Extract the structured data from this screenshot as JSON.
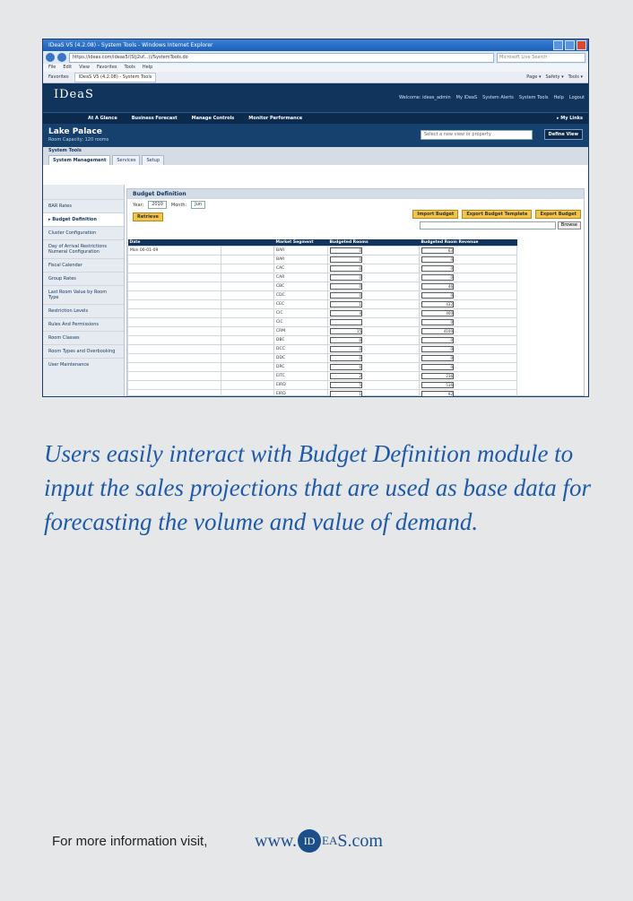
{
  "screenshot": {
    "window_title": "IDeaS V5 (4.2.08) - System Tools - Windows Internet Explorer",
    "url": "https://ideas.com/ideas5/(S(j2uf...))/SystemTools.do",
    "search_placeholder": "Microsoft Live Search",
    "menu": [
      "File",
      "Edit",
      "View",
      "Favorites",
      "Tools",
      "Help"
    ],
    "favorites_label": "Favorites",
    "tab_label": "IDeaS V5 (4.2.08) - System Tools",
    "commands": [
      "Page ▾",
      "Safety ▾",
      "Tools ▾"
    ],
    "logo": "IDeaS",
    "top_links": [
      "Welcome: ideas_admin",
      "My IDeaS",
      "System Alerts",
      "System Tools",
      "Help",
      "Logout"
    ],
    "nav": [
      "At A Glance",
      "Business Forecast",
      "Manage Controls",
      "Monitor Performance"
    ],
    "nav_right": "▸ My Links",
    "property_name": "Lake Palace",
    "property_sub": "Room Capacity: 120 rooms",
    "property_select": "Select a new view or property",
    "define_view": "Define View",
    "system_tools": "System Tools",
    "subtabs": [
      "System Management",
      "Services",
      "Setup"
    ],
    "side_items": [
      "BAR Rates",
      "▸ Budget Definition",
      "Cluster Configuration",
      "Day of Arrival Restrictions Numeral Configuration",
      "Fiscal Calendar",
      "Group Rates",
      "Last Room Value by Room Type",
      "Restriction Levels",
      "Rules And Permissions",
      "Room Classes",
      "Room Types and Overbooking",
      "User Maintenance"
    ],
    "panel_title": "Budget Definition",
    "year_label": "Year:",
    "year_value": "2010",
    "month_label": "Month:",
    "month_value": "Jun",
    "retrieve": "Retrieve",
    "buttons": [
      "Import Budget",
      "Export Budget Template",
      "Export Budget"
    ],
    "browse": "Browse",
    "columns": [
      "Date",
      "Market Segment",
      "Budgeted Rooms",
      "Budgeted Room Revenue"
    ],
    "date_value": "Mon 06-01-09",
    "rows": [
      {
        "seg": "BAR",
        "rooms": "0",
        "rev": "63"
      },
      {
        "seg": "BAR",
        "rooms": "0",
        "rev": "0"
      },
      {
        "seg": "CAC",
        "rooms": "0",
        "rev": "0"
      },
      {
        "seg": "CAR",
        "rooms": "0",
        "rev": "0"
      },
      {
        "seg": "CBC",
        "rooms": "0",
        "rev": "46"
      },
      {
        "seg": "CDC",
        "rooms": "0",
        "rev": "0"
      },
      {
        "seg": "CEC",
        "rooms": "1",
        "rev": "432"
      },
      {
        "seg": "CIC",
        "rooms": "4",
        "rev": "400"
      },
      {
        "seg": "CIC",
        "rooms": "",
        "rev": "0"
      },
      {
        "seg": "CRM",
        "rooms": "15",
        "rev": "4100"
      },
      {
        "seg": "DBC",
        "rooms": "0",
        "rev": "0"
      },
      {
        "seg": "DCC",
        "rooms": "0",
        "rev": "0"
      },
      {
        "seg": "DDC",
        "rooms": "0",
        "rev": "0"
      },
      {
        "seg": "DRC",
        "rooms": "0",
        "rev": "0"
      },
      {
        "seg": "EITC",
        "rooms": "2",
        "rev": "236"
      },
      {
        "seg": "EIRD",
        "rooms": "5",
        "rev": "516"
      },
      {
        "seg": "EIRD",
        "rooms": "1",
        "rev": "92"
      }
    ]
  },
  "caption": "Users easily interact with Budget Definition module to input the sales projections that are used as base data for forecasting the volume and value of demand.",
  "footer_text": "For more information visit,",
  "web_prefix": "www.",
  "web_logo": "ID",
  "web_mid": "EA",
  "web_suffix": "S.com",
  "colors": {
    "caption": "#1e5aa8",
    "navy": "#11345c",
    "background": "#e6e7e8"
  }
}
